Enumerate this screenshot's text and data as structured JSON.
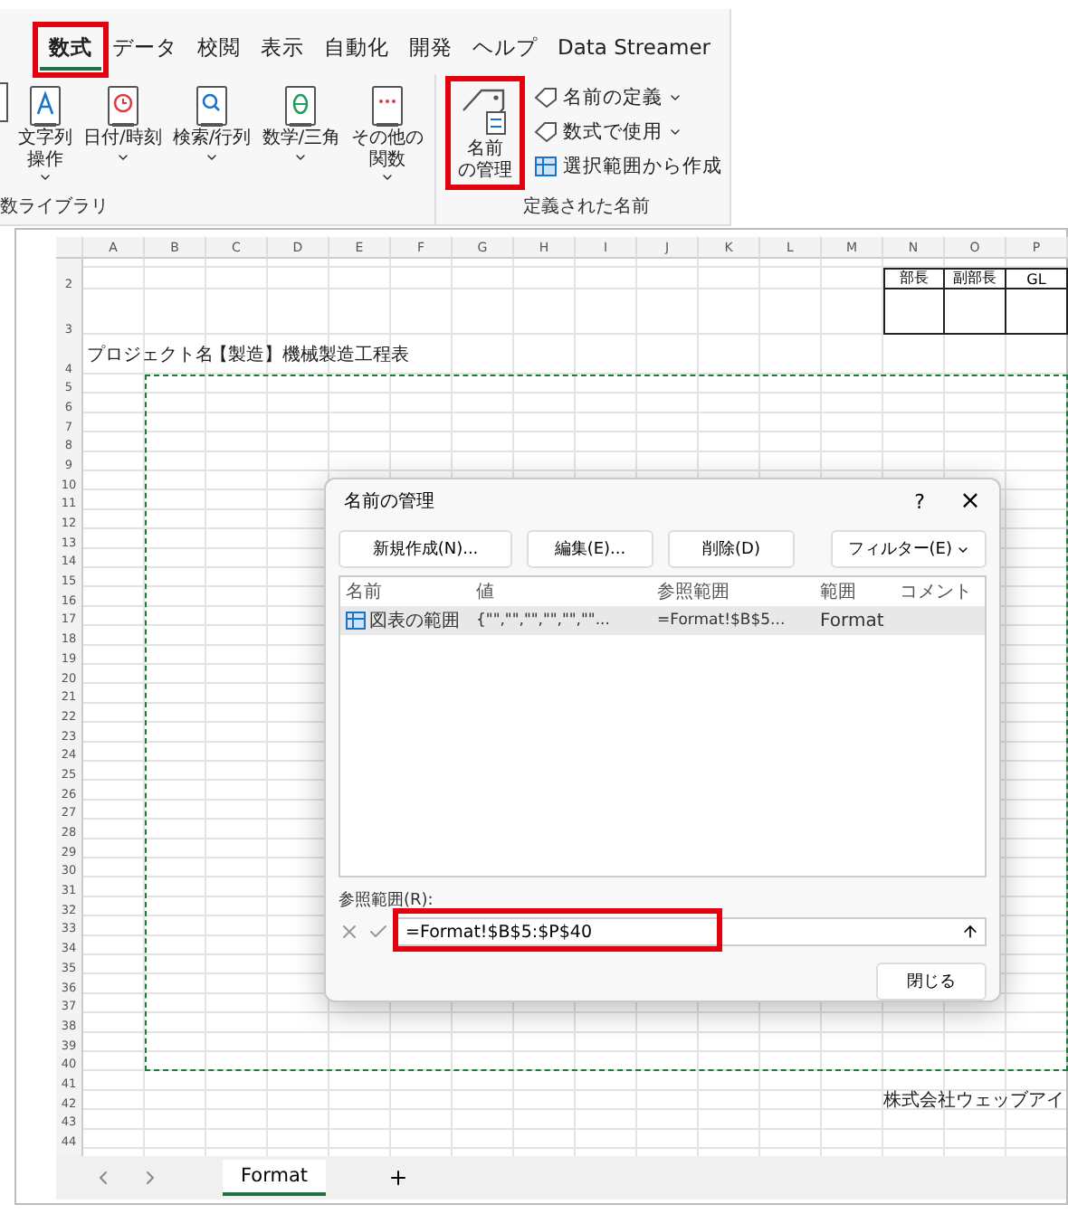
{
  "ribbon": {
    "tabs": [
      {
        "label": "数式",
        "selected": true,
        "highlighted": true
      },
      {
        "label": "データ",
        "selected": false,
        "highlighted": false
      },
      {
        "label": "校閲",
        "selected": false,
        "highlighted": false
      },
      {
        "label": "表示",
        "selected": false,
        "highlighted": false
      },
      {
        "label": "自動化",
        "selected": false,
        "highlighted": false
      },
      {
        "label": "開発",
        "selected": false,
        "highlighted": false
      },
      {
        "label": "ヘルプ",
        "selected": false,
        "highlighted": false
      },
      {
        "label": "Data Streamer",
        "selected": false,
        "highlighted": false
      }
    ],
    "library": {
      "label": "数ライブラリ",
      "buttons": [
        {
          "lines": [
            "文字列",
            "操作"
          ],
          "dropdown": true
        },
        {
          "lines": [
            "日付/時刻"
          ],
          "dropdown": true
        },
        {
          "lines": [
            "検索/行列"
          ],
          "dropdown": true
        },
        {
          "lines": [
            "数学/三角"
          ],
          "dropdown": true
        },
        {
          "lines": [
            "その他の",
            "関数"
          ],
          "dropdown": true
        }
      ]
    },
    "names": {
      "label": "定義された名前",
      "big_button": {
        "lines": [
          "名前",
          "の管理"
        ],
        "highlighted": true
      },
      "items": [
        {
          "label": "名前の定義",
          "dropdown": true
        },
        {
          "label": "数式で使用",
          "dropdown": true
        },
        {
          "label": "選択範囲から作成",
          "dropdown": false
        }
      ]
    }
  },
  "sheet": {
    "columns": [
      "A",
      "B",
      "C",
      "D",
      "E",
      "F",
      "G",
      "H",
      "I",
      "J",
      "K",
      "L",
      "M",
      "N",
      "O",
      "P"
    ],
    "rows": [
      "2",
      "3",
      "4",
      "5",
      "6",
      "7",
      "8",
      "9",
      "10",
      "11",
      "12",
      "13",
      "14",
      "15",
      "16",
      "17",
      "18",
      "19",
      "20",
      "21",
      "22",
      "23",
      "24",
      "25",
      "26",
      "27",
      "28",
      "29",
      "30",
      "31",
      "32",
      "33",
      "34",
      "35",
      "36",
      "37",
      "38",
      "39",
      "40",
      "41",
      "42",
      "43",
      "44"
    ],
    "approvers": [
      "部長",
      "副部長",
      "GL"
    ],
    "project_label": "プロジェクト名",
    "project_name": "【製造】機械製造工程表",
    "company": "株式会社ウェッブアイ",
    "tabs": [
      {
        "label": "Format",
        "selected": true
      }
    ]
  },
  "dialog": {
    "title": "名前の管理",
    "help": "?",
    "close": "×",
    "buttons": [
      "新規作成(N)...",
      "編集(E)...",
      "削除(D)"
    ],
    "filter": "フィルター(E)",
    "columns": [
      "名前",
      "値",
      "参照範囲",
      "範囲",
      "コメント"
    ],
    "rows": [
      {
        "selected": true,
        "cells": [
          "図表の範囲",
          "{\"\",\"\",\"\",\"\",\"\",\"\"...",
          "=Format!$B$5...",
          "Format"
        ]
      }
    ],
    "ref_label": "参照範囲(R):",
    "ref_value": "=Format!$B$5:$P$40",
    "ref_highlighted": true,
    "close_button": "閉じる"
  }
}
